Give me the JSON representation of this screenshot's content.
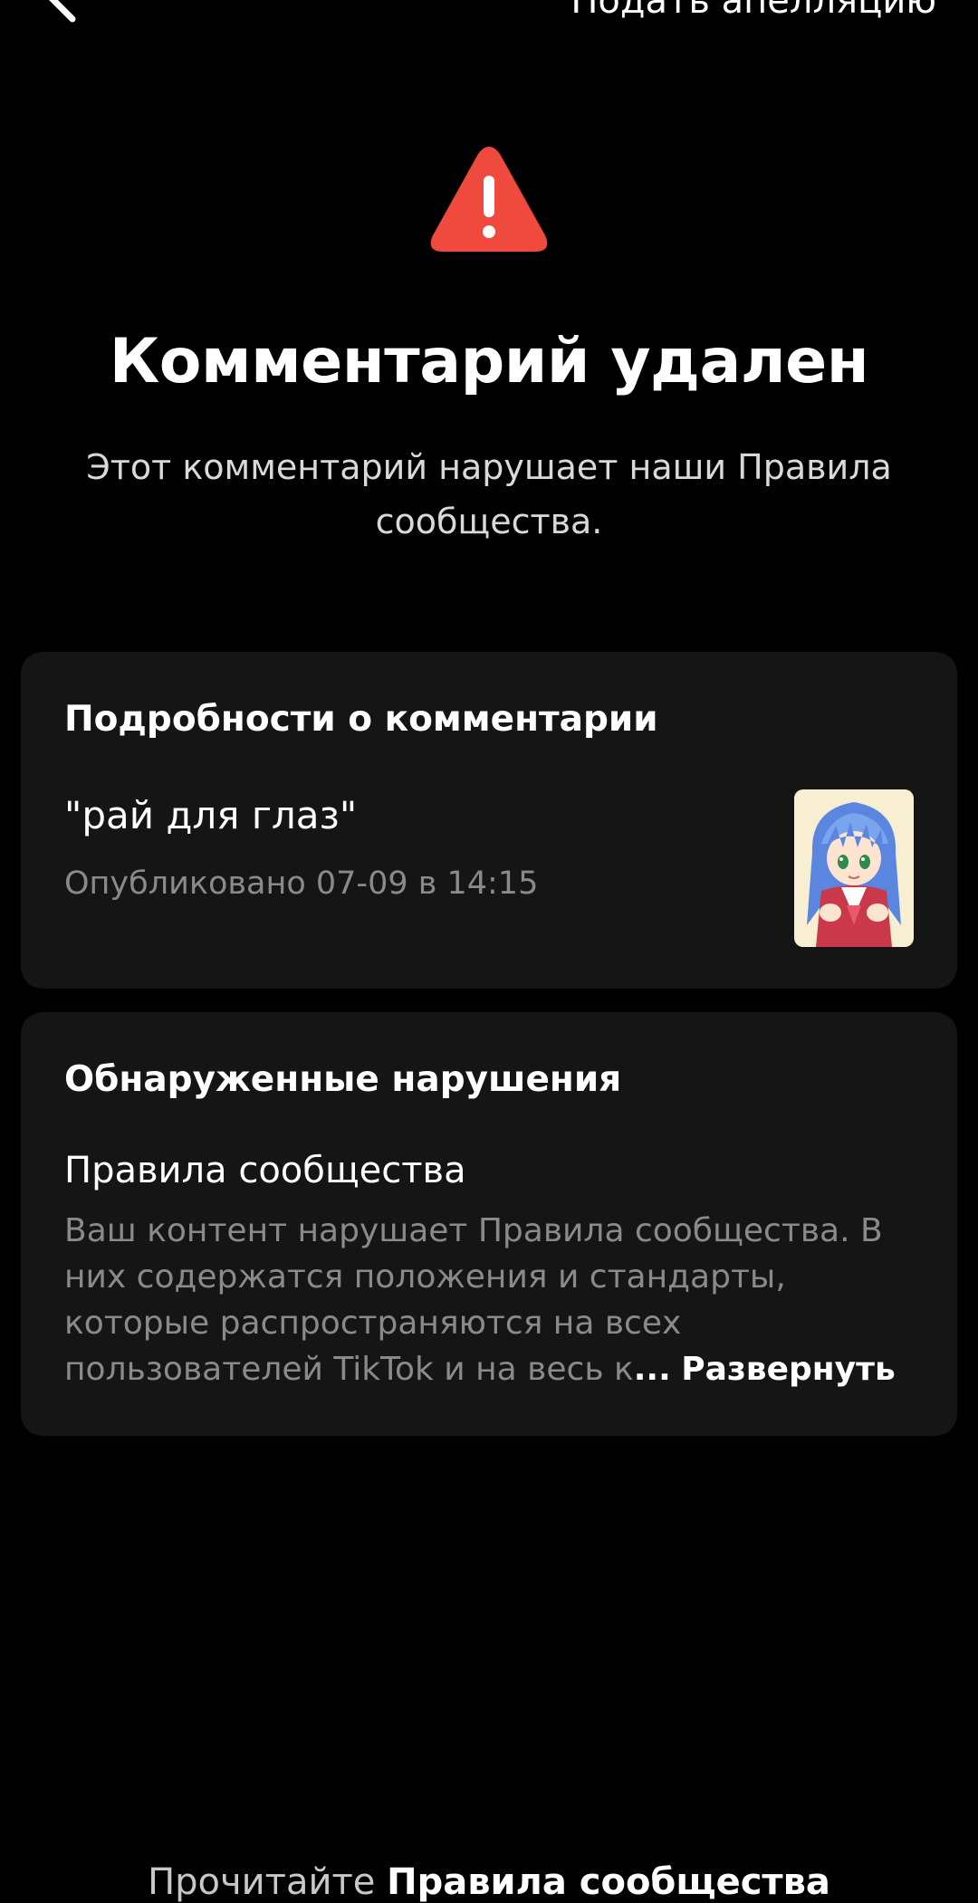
{
  "header": {
    "back_icon": "arrow-left-icon",
    "appeal_label": "Подать апелляцию"
  },
  "status": {
    "icon": "warning-triangle-icon",
    "icon_color": "#f04a3e",
    "title": "Комментарий удален",
    "description": "Этот комментарий нарушает наши Правила сообщества."
  },
  "details": {
    "title": "Подробности о комментарии",
    "comment": "\"рай для глаз\"",
    "posted": "Опубликовано 07-09 в 14:15",
    "thumbnail_icon": "anime-avatar-thumbnail"
  },
  "violations": {
    "title": "Обнаруженные нарушения",
    "rule_title": "Правила сообщества",
    "rule_lines": [
      "Ваш контент нарушает Правила сообщества. В",
      "них содержатся положения и стандарты,",
      "которые распространяются на всех",
      "пользователей TikTok и на весь к"
    ],
    "ellipsis": "...",
    "expand_label": "Развернуть"
  },
  "footer": {
    "prefix": "Прочитайте",
    "link": "Правила сообщества"
  },
  "colors": {
    "background": "#000000",
    "card": "#151515",
    "muted_text": "#8a8a8a",
    "warning": "#f04a3e"
  }
}
